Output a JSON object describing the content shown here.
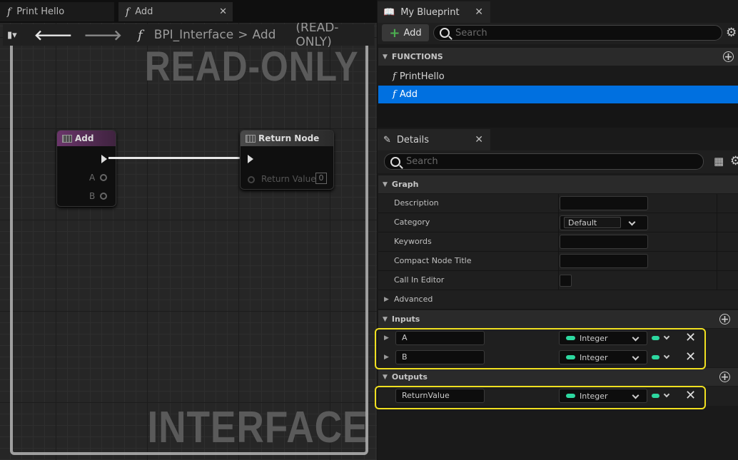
{
  "tabs": [
    {
      "label": "Print Hello",
      "icon": "function-icon"
    },
    {
      "label": "Add",
      "icon": "function-icon",
      "close": "✕"
    }
  ],
  "graph": {
    "breadcrumb_root": "BPI_Interface",
    "breadcrumb_sep": ">",
    "breadcrumb_leaf": "Add",
    "readonly_tag": "(READ-ONLY)",
    "watermark_top": "READ-ONLY",
    "watermark_bottom": "INTERFACE",
    "nodes": {
      "add": {
        "title": "Add",
        "header_color": "#5c2f5c",
        "pins": [
          "A",
          "B"
        ]
      },
      "return": {
        "title": "Return Node",
        "header_color": "#3a3a3a",
        "pin": "Return Value",
        "value": "0"
      }
    }
  },
  "my_blueprint": {
    "title": "My Blueprint",
    "close": "✕",
    "add_label": "Add",
    "search_placeholder": "Search",
    "section": "FUNCTIONS",
    "functions": [
      {
        "label": "PrintHello",
        "selected": false
      },
      {
        "label": "Add",
        "selected": true
      }
    ]
  },
  "details": {
    "title": "Details",
    "close": "✕",
    "search_placeholder": "Search",
    "graph_section": "Graph",
    "graph_rows": {
      "description": "Description",
      "category": "Category",
      "category_value": "Default",
      "keywords": "Keywords",
      "compact": "Compact Node Title",
      "call_in_editor": "Call In Editor"
    },
    "advanced": "Advanced",
    "inputs_section": "Inputs",
    "inputs": [
      {
        "name": "A",
        "type": "Integer"
      },
      {
        "name": "B",
        "type": "Integer"
      }
    ],
    "outputs_section": "Outputs",
    "outputs": [
      {
        "name": "ReturnValue",
        "type": "Integer"
      }
    ]
  },
  "colors": {
    "accent": "#0070e0",
    "highlight": "#f0e020",
    "integer_pin": "#2dd8a0"
  }
}
